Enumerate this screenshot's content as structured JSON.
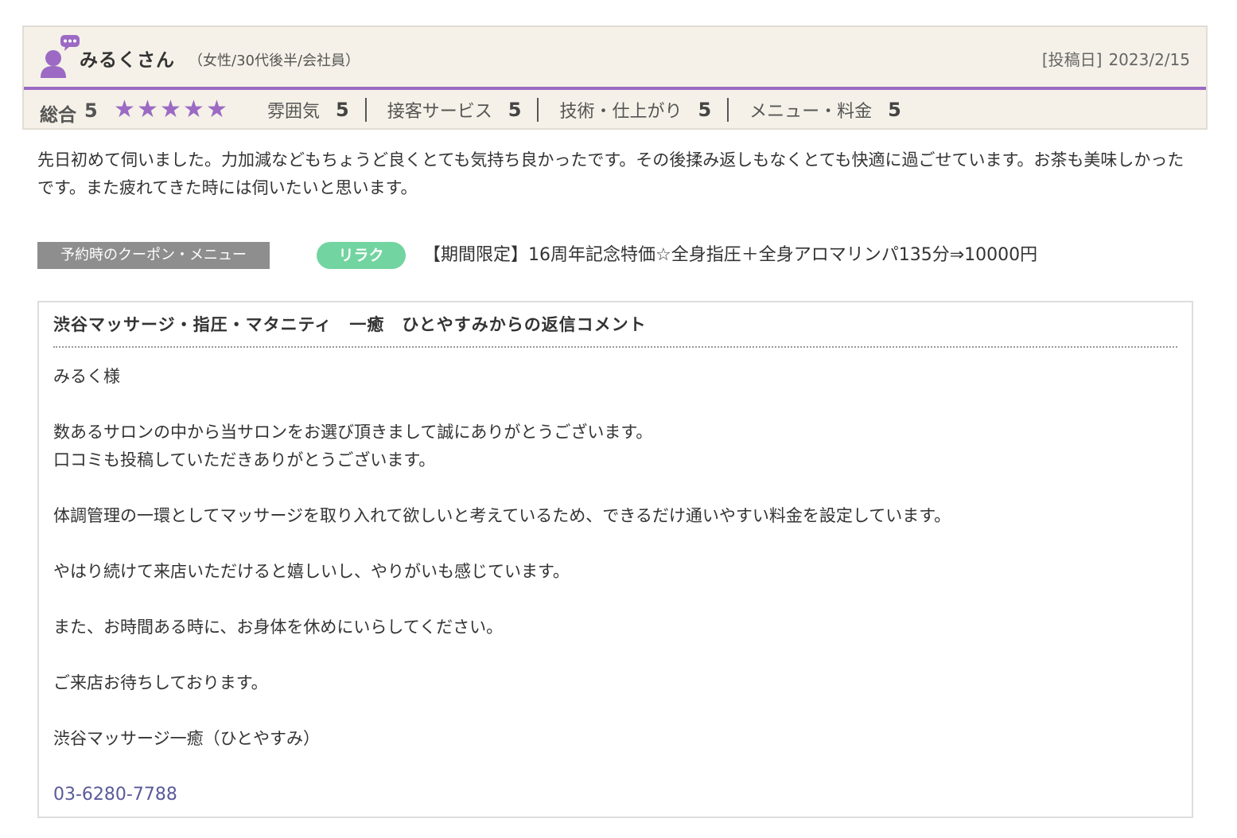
{
  "reviewer": {
    "name": "みるくさん",
    "profile": "（女性/30代後半/会社員）",
    "date_label": "[投稿日]",
    "date": "2023/2/15",
    "avatar_icon": "user-speech-bubble-icon"
  },
  "rating": {
    "overall_label": "総合",
    "overall_score": "5",
    "stars": 5,
    "star_color": "#9c6ac4",
    "categories": [
      {
        "label": "雰囲気",
        "score": "5"
      },
      {
        "label": "接客サービス",
        "score": "5"
      },
      {
        "label": "技術・仕上がり",
        "score": "5"
      },
      {
        "label": "メニュー・料金",
        "score": "5"
      }
    ]
  },
  "review": {
    "text": "先日初めて伺いました。力加減などもちょうど良くとても気持ち良かったです。その後揉み返しもなくとても快適に過ごせています。お茶も美味しかったです。また疲れてきた時には伺いたいと思います。"
  },
  "coupon": {
    "label": "予約時のクーポン・メニュー",
    "tag": "リラク",
    "tag_color": "#72d4a0",
    "text": "【期間限定】16周年記念特価☆全身指圧＋全身アロマリンパ135分⇒10000円"
  },
  "reply": {
    "title": "渋谷マッサージ・指圧・マタニティ　一癒　ひとやすみからの返信コメント",
    "lines": [
      "みるく様",
      "",
      "数あるサロンの中から当サロンをお選び頂きまして誠にありがとうございます。",
      "口コミも投稿していただきありがとうございます。",
      "",
      "体調管理の一環としてマッサージを取り入れて欲しいと考えているため、できるだけ通いやすい料金を設定しています。",
      "",
      "やはり続けて来店いただけると嬉しいし、やりがいも感じています。",
      "",
      "また、お時間ある時に、お身体を休めにいらしてください。",
      "",
      "ご来店お待ちしております。",
      "",
      "渋谷マッサージ一癒（ひとやすみ）",
      ""
    ],
    "phone": "03-6280-7788"
  },
  "colors": {
    "accent_purple": "#9c6ac4",
    "header_bg": "#f5f1e8",
    "phone_link": "#5a5a9a"
  }
}
